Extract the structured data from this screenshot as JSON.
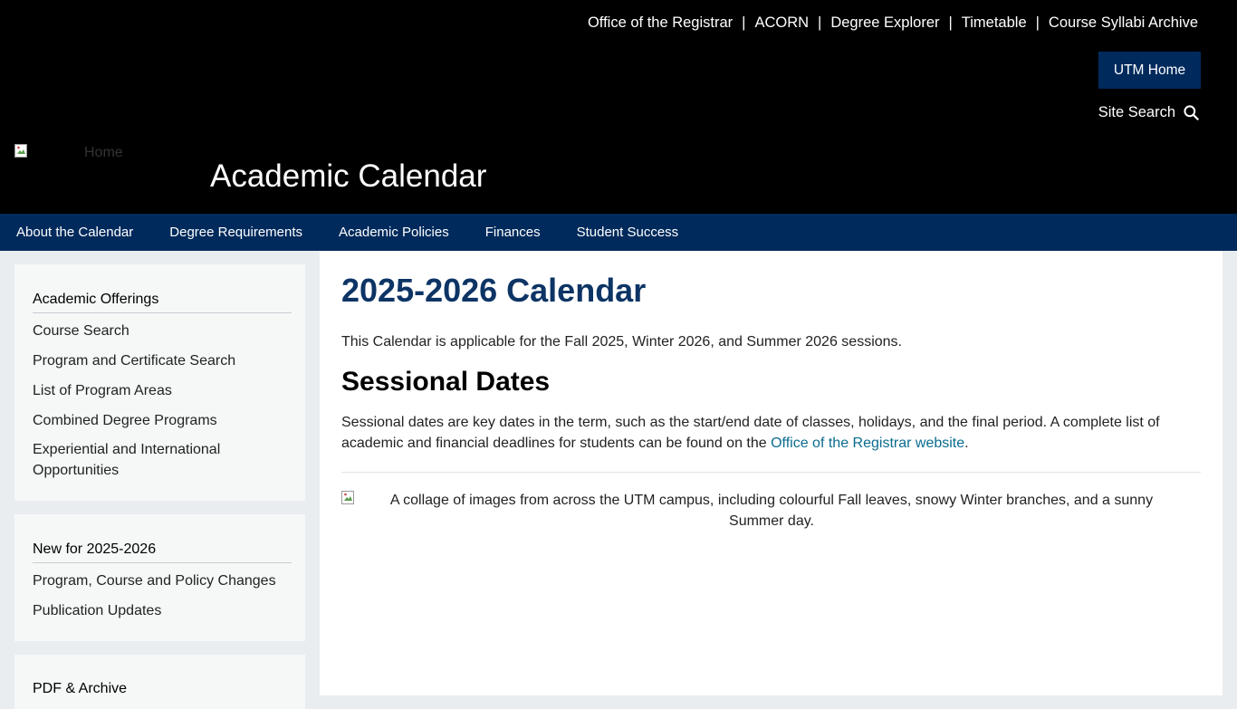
{
  "header": {
    "top_links": [
      {
        "label": "Office of the Registrar"
      },
      {
        "label": "ACORN"
      },
      {
        "label": "Degree Explorer"
      },
      {
        "label": "Timetable"
      },
      {
        "label": "Course Syllabi Archive"
      }
    ],
    "separator": "|",
    "utm_home_label": "UTM Home",
    "site_search_label": "Site Search",
    "logo_alt": "Home",
    "title": "Academic Calendar"
  },
  "nav": {
    "items": [
      {
        "label": "About the Calendar"
      },
      {
        "label": "Degree Requirements"
      },
      {
        "label": "Academic Policies"
      },
      {
        "label": "Finances"
      },
      {
        "label": "Student Success"
      }
    ]
  },
  "sidebar": {
    "box1": {
      "title": "Academic Offerings",
      "links": [
        {
          "label": "Course Search"
        },
        {
          "label": "Program and Certificate Search"
        },
        {
          "label": "List of Program Areas"
        },
        {
          "label": "Combined Degree Programs"
        },
        {
          "label": "Experiential and International Opportunities"
        }
      ]
    },
    "box2": {
      "title": "New for 2025-2026",
      "links": [
        {
          "label": "Program, Course and Policy Changes"
        },
        {
          "label": "Publication Updates"
        }
      ]
    },
    "box3": {
      "title": "PDF & Archive"
    }
  },
  "main": {
    "heading": "2025-2026 Calendar",
    "intro": "This Calendar is applicable for the Fall 2025, Winter 2026, and Summer 2026 sessions.",
    "sessional_heading": "Sessional Dates",
    "sessional_text": "Sessional dates are key dates in the term, such as the start/end date of classes, holidays, and the final period. A complete list of academic and financial deadlines for students can be found on the ",
    "sessional_link": "Office of the Registrar website",
    "sessional_end": ".",
    "collage_alt": "A collage of images from across the UTM campus, including colourful Fall leaves, snowy Winter branches, and a sunny Summer day."
  },
  "colors": {
    "header_bg": "#000000",
    "nav_bg": "#002a5c",
    "heading_blue": "#0d3465",
    "link_teal": "#0a6c8e",
    "page_bg": "#e9edf0",
    "sidebar_bg": "#f6f8f8"
  },
  "icons": {
    "search": "magnifier-icon",
    "broken_image": "broken-image-icon"
  }
}
